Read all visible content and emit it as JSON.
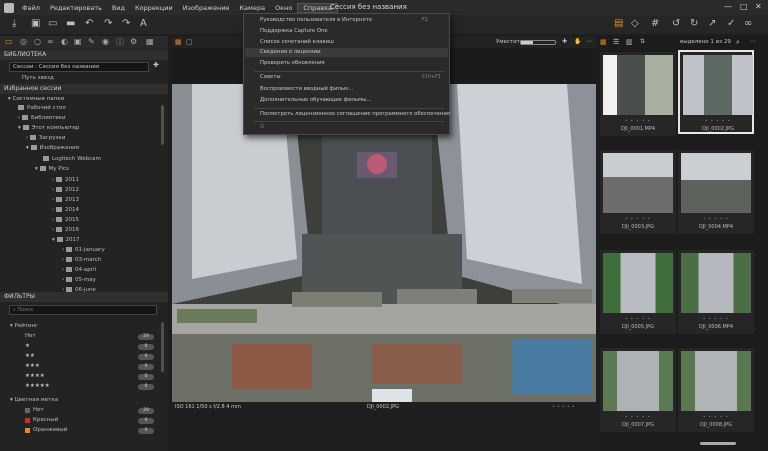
{
  "menu": {
    "items": [
      "Файл",
      "Редактировать",
      "Вид",
      "Коррекции",
      "Изображение",
      "Камера",
      "Окно",
      "Справка"
    ],
    "active_index": 7,
    "window_title": "Сессия без названия",
    "controls": [
      "—",
      "□",
      "✕"
    ]
  },
  "help_menu": {
    "items": [
      {
        "label": "Руководство пользователя в Интернете",
        "shortcut": "F1",
        "highlighted": false,
        "disabled": false
      },
      {
        "label": "Поддержка Capture One",
        "shortcut": "",
        "highlighted": false,
        "disabled": false
      },
      {
        "label": "Список сочетаний клавиш",
        "shortcut": "",
        "highlighted": false,
        "disabled": false
      },
      {
        "label": "Сведения о лицензии",
        "shortcut": "",
        "highlighted": true,
        "disabled": false
      },
      {
        "label": "Проверить обновления",
        "shortcut": "",
        "highlighted": false,
        "disabled": false
      },
      {
        "label": "Советы",
        "shortcut": "Ctrl+F1",
        "highlighted": false,
        "disabled": false
      },
      {
        "label": "Воспроизвести вводный фильм...",
        "shortcut": "",
        "highlighted": false,
        "disabled": false
      },
      {
        "label": "Дополнительные обучающие фильмы...",
        "shortcut": "",
        "highlighted": false,
        "disabled": false
      },
      {
        "label": "Посмотреть лицензионное соглашение программного обеспечения",
        "shortcut": "",
        "highlighted": false,
        "disabled": false
      },
      {
        "label": "О",
        "shortcut": "",
        "highlighted": false,
        "disabled": true
      }
    ]
  },
  "library": {
    "header": "БИБЛИОТЕКА",
    "session_label": "Сессии : Сессия без названия",
    "five_stars_path": "Путь звезд",
    "favorites": "Избранное сессии",
    "system_folders": "Системные папки",
    "tree": [
      "Рабочий стол",
      "Библиотеки",
      "Этот компьютер",
      "Загрузки",
      "Изображения",
      "Logitech Webcam",
      "My Pics",
      "2011",
      "2012",
      "2013",
      "2014",
      "2015",
      "2016",
      "2017",
      "01-january",
      "03-march",
      "04-april",
      "05-may",
      "06-june"
    ]
  },
  "filters": {
    "header": "ФИЛЬТРЫ",
    "search_placeholder": "Поиск",
    "rating_header": "Рейтинг",
    "ratings": [
      {
        "label": "Нет",
        "count": "29"
      },
      {
        "label": "★",
        "count": "0"
      },
      {
        "label": "★★",
        "count": "0"
      },
      {
        "label": "★★★",
        "count": "0"
      },
      {
        "label": "★★★★",
        "count": "0"
      },
      {
        "label": "★★★★★",
        "count": "0"
      }
    ],
    "color_header": "Цветная метка",
    "colors": [
      {
        "label": "Нет",
        "count": "29",
        "color": "#666666"
      },
      {
        "label": "Красный",
        "count": "0",
        "color": "#d62d20"
      },
      {
        "label": "Оранжевый",
        "count": "0",
        "color": "#e58a1f"
      }
    ]
  },
  "browser": {
    "fit_label": "Уместить",
    "selected_text": "выделено 1 из 29",
    "thumbnails": [
      {
        "name": "DJI_0001.MP4",
        "selected": false
      },
      {
        "name": "DJI_0002.JPG",
        "selected": true
      },
      {
        "name": "DJI_0003.JPG",
        "selected": false
      },
      {
        "name": "DJI_0004.MP4",
        "selected": false
      },
      {
        "name": "DJI_0005.JPG",
        "selected": false
      },
      {
        "name": "DJI_0006.MP4",
        "selected": false
      },
      {
        "name": "DJI_0007.JPG",
        "selected": false
      },
      {
        "name": "DJI_0008.JPG",
        "selected": false
      }
    ]
  },
  "viewer": {
    "exif": "ISO 161  1/50 s  f/2.8  4 mm",
    "filename": "DJI_0002.JPG"
  },
  "colors": {
    "accent": "#e58a1f",
    "panel": "#232323",
    "menu_bg": "#2b2b2b"
  }
}
